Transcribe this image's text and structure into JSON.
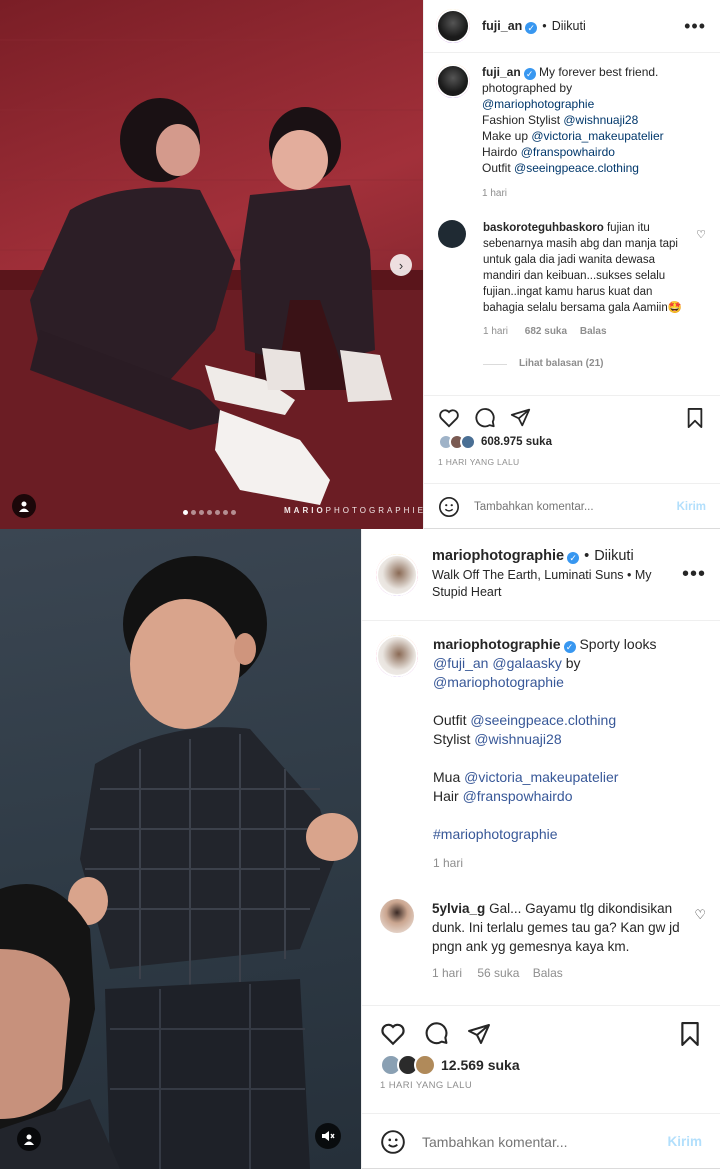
{
  "post1": {
    "header": {
      "username": "fuji_an",
      "follow_status": "Diikuti"
    },
    "caption": {
      "username": "fuji_an",
      "line1": "My forever best friend.",
      "line2": "photographed by",
      "photographer": "@mariophotographie",
      "stylist_label": "Fashion Stylist",
      "stylist": "@wishnuaji28",
      "makeup_label": "Make up",
      "makeup": "@victoria_makeupatelier",
      "hair_label": "Hairdo",
      "hair": "@franspowhairdo",
      "outfit_label": "Outfit",
      "outfit": "@seeingpeace.clothing",
      "time": "1 hari"
    },
    "comment": {
      "username": "baskoroteguhbaskoro",
      "text": "fujian itu sebenarnya masih abg dan manja tapi untuk gala dia jadi wanita dewasa mandiri dan keibuan...sukses selalu fujian..ingat kamu harus kuat dan bahagia selalu bersama gala Aamiin🤩",
      "time": "1 hari",
      "likes": "682 suka",
      "reply": "Balas",
      "view_replies": "Lihat balasan (21)"
    },
    "likes": "608.975 suka",
    "date": "1 HARI YANG LALU",
    "comment_placeholder": "Tambahkan komentar...",
    "send_label": "Kirim",
    "watermark_bold": "MARIO",
    "watermark_light": "PHOTOGRAPHIE",
    "carousel": {
      "count": 7,
      "active": 0
    }
  },
  "post2": {
    "header": {
      "username": "mariophotographie",
      "follow_status": "Diikuti",
      "audio": "Walk Off The Earth, Luminati Suns • My Stupid Heart"
    },
    "caption": {
      "username": "mariophotographie",
      "title": "Sporty looks",
      "tag1": "@fuji_an",
      "tag2": "@galaasky",
      "by": "by",
      "photographer": "@mariophotographie",
      "outfit_label": "Outfit",
      "outfit": "@seeingpeace.clothing",
      "stylist_label": "Stylist",
      "stylist": "@wishnuaji28",
      "mua_label": "Mua",
      "mua": "@victoria_makeupatelier",
      "hair_label": "Hair",
      "hair": "@franspowhairdo",
      "hashtag": "#mariophotographie",
      "time": "1 hari"
    },
    "comment": {
      "username": "5ylvia_g",
      "text": "Gal... Gayamu tlg dikondisikan dunk. Ini terlalu gemes tau ga? Kan gw jd pngn ank yg gemesnya kaya km.",
      "time": "1 hari",
      "likes": "56 suka",
      "reply": "Balas"
    },
    "likes": "12.569 suka",
    "date": "1 HARI YANG LALU",
    "comment_placeholder": "Tambahkan komentar...",
    "send_label": "Kirim"
  },
  "icons": {
    "verified": "verified-badge-icon",
    "heart": "heart-icon",
    "comment": "comment-icon",
    "share": "share-icon",
    "bookmark": "bookmark-icon",
    "emoji": "emoji-icon",
    "more": "more-options-icon",
    "user_tag": "user-tag-icon",
    "mute": "mute-icon",
    "next": "chevron-right-icon"
  },
  "colors": {
    "link": "#00376b",
    "tag": "#385898",
    "muted": "#8e8e8e",
    "verified": "#3897f0",
    "send_disabled": "#b2dffc"
  }
}
